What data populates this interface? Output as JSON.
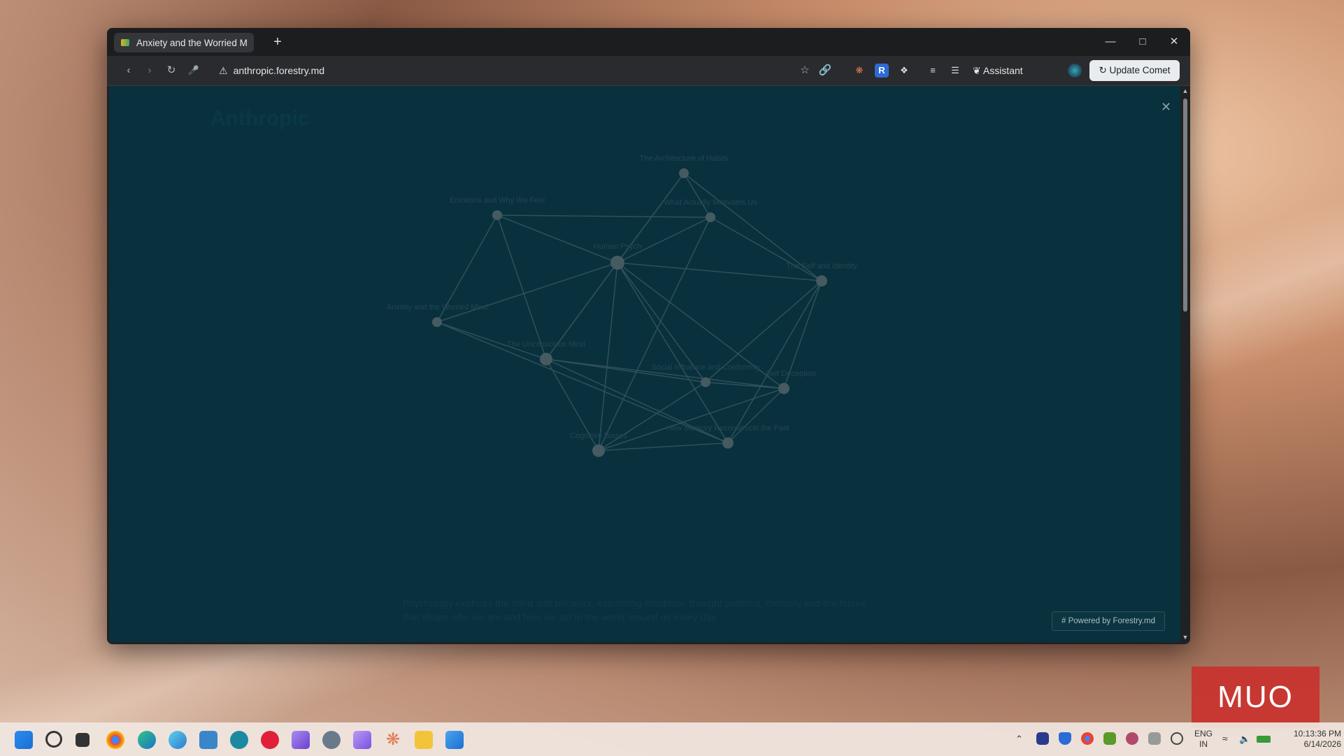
{
  "browser": {
    "tab_title": "Anxiety and the Worried M",
    "address": "anthropic.forestry.md",
    "assistant_label": "Assistant",
    "update_label": "Update Comet"
  },
  "page": {
    "brand_ghost": "Anthropic",
    "close_symbol": "✕",
    "powered_label": "Powered by Forestry.md",
    "ghost_paragraph": "Psychology explores the mind and behavior, examining emotions, thought patterns, memory and the forces that shape who we are and how we act in the world around us every day."
  },
  "graph": {
    "nodes": [
      {
        "id": "habits",
        "label": "The Architecture of Habits"
      },
      {
        "id": "emotions",
        "label": "Emotions and Why We Feel"
      },
      {
        "id": "motivates",
        "label": "What Actually Motivates Us"
      },
      {
        "id": "psych",
        "label": "Human Psych"
      },
      {
        "id": "self",
        "label": "The Self and Identity"
      },
      {
        "id": "anxiety",
        "label": "Anxiety and the Worried Mind"
      },
      {
        "id": "unconscious",
        "label": "The Unconscious Mind"
      },
      {
        "id": "social",
        "label": "Social Influence and Conformity"
      },
      {
        "id": "deception",
        "label": "Self Deception"
      },
      {
        "id": "cognitive",
        "label": "Cognitive Biases"
      },
      {
        "id": "memory",
        "label": "How Memory Reconstructs the Past"
      }
    ],
    "edges": [
      [
        "habits",
        "motivates"
      ],
      [
        "habits",
        "self"
      ],
      [
        "habits",
        "psych"
      ],
      [
        "habits",
        "unconscious"
      ],
      [
        "emotions",
        "motivates"
      ],
      [
        "emotions",
        "psych"
      ],
      [
        "emotions",
        "anxiety"
      ],
      [
        "emotions",
        "unconscious"
      ],
      [
        "motivates",
        "psych"
      ],
      [
        "motivates",
        "self"
      ],
      [
        "motivates",
        "cognitive"
      ],
      [
        "psych",
        "self"
      ],
      [
        "psych",
        "anxiety"
      ],
      [
        "psych",
        "unconscious"
      ],
      [
        "psych",
        "social"
      ],
      [
        "psych",
        "deception"
      ],
      [
        "psych",
        "cognitive"
      ],
      [
        "psych",
        "memory"
      ],
      [
        "self",
        "social"
      ],
      [
        "self",
        "deception"
      ],
      [
        "self",
        "memory"
      ],
      [
        "anxiety",
        "unconscious"
      ],
      [
        "anxiety",
        "memory"
      ],
      [
        "unconscious",
        "social"
      ],
      [
        "unconscious",
        "deception"
      ],
      [
        "unconscious",
        "cognitive"
      ],
      [
        "unconscious",
        "memory"
      ],
      [
        "social",
        "deception"
      ],
      [
        "social",
        "cognitive"
      ],
      [
        "deception",
        "cognitive"
      ],
      [
        "deception",
        "memory"
      ],
      [
        "cognitive",
        "memory"
      ]
    ]
  },
  "taskbar": {
    "lang_top": "ENG",
    "lang_bottom": "IN",
    "time": "10:13:36 PM",
    "date": "6/14/2026"
  },
  "watermark": {
    "text": "MUO"
  },
  "colors": {
    "page_bg": "#0c3a48",
    "node": "#5e7278",
    "edge": "#3f6670",
    "label": "#2c5864"
  }
}
